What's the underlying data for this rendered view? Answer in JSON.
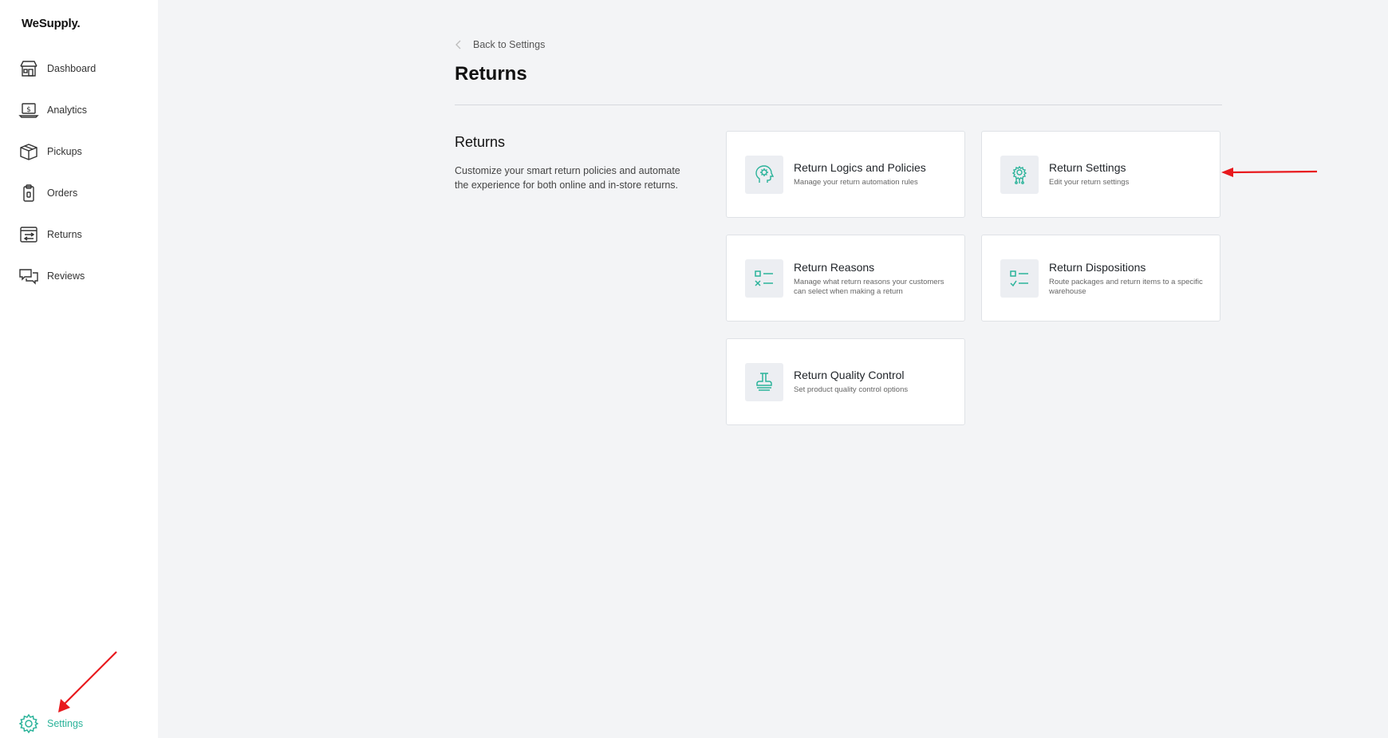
{
  "sidebar": {
    "logo": "WeSupply.",
    "items": [
      {
        "label": "Dashboard",
        "icon": "store-icon"
      },
      {
        "label": "Analytics",
        "icon": "laptop-dollar-icon"
      },
      {
        "label": "Pickups",
        "icon": "package-icon"
      },
      {
        "label": "Orders",
        "icon": "clipboard-icon"
      },
      {
        "label": "Returns",
        "icon": "returns-arrows-icon"
      },
      {
        "label": "Reviews",
        "icon": "chat-bubbles-icon"
      }
    ],
    "settings": {
      "label": "Settings",
      "icon": "gear-icon",
      "color": "#2bb39a"
    }
  },
  "header": {
    "back_label": "Back to Settings",
    "title": "Returns"
  },
  "section": {
    "title": "Returns",
    "description": "Customize your smart return policies and automate the experience for both online and in-store returns."
  },
  "cards": [
    {
      "title": "Return Logics and Policies",
      "desc": "Manage your return automation rules",
      "icon": "brain-gear-icon"
    },
    {
      "title": "Return Settings",
      "desc": "Edit your return settings",
      "icon": "circuit-gear-icon"
    },
    {
      "title": "Return Reasons",
      "desc": "Manage what return reasons your customers can select when making a return",
      "icon": "checklist-x-icon"
    },
    {
      "title": "Return Dispositions",
      "desc": "Route packages and return items to a specific warehouse",
      "icon": "checklist-check-icon"
    },
    {
      "title": "Return Quality Control",
      "desc": "Set product quality control options",
      "icon": "stamp-icon"
    }
  ],
  "colors": {
    "accent": "#2bb39a",
    "annotation": "#e8191d"
  }
}
